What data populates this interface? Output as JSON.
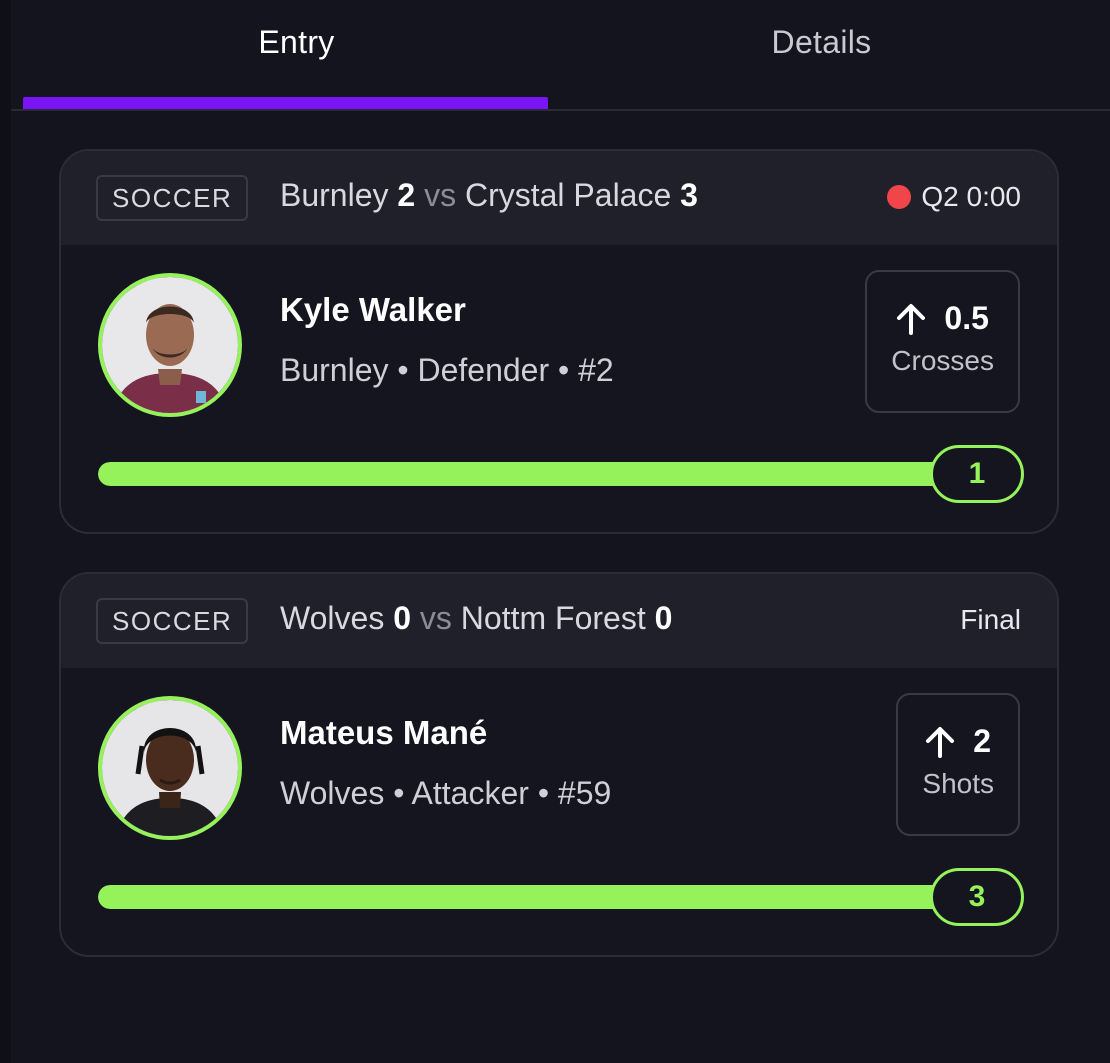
{
  "tabs": [
    {
      "label": "Entry",
      "active": true
    },
    {
      "label": "Details",
      "active": false
    }
  ],
  "colors": {
    "background": "#14141f",
    "accent_purple": "#7a14f5",
    "accent_green": "#95f25a",
    "live_red": "#f2454a"
  },
  "cards": [
    {
      "sport": "SOCCER",
      "home_team": "Burnley",
      "home_score": "2",
      "vs": "vs",
      "away_team": "Crystal Palace",
      "away_score": "3",
      "status": "Q2 0:00",
      "live": true,
      "player": {
        "name": "Kyle Walker",
        "meta": "Burnley • Defender • #2",
        "avatar_icon": "player-photo-icon"
      },
      "pick": {
        "direction": "up",
        "arrow_icon": "arrow-up-icon",
        "line": "0.5",
        "stat": "Crosses"
      },
      "progress": {
        "current": "1",
        "fill_fraction": 1.0
      }
    },
    {
      "sport": "SOCCER",
      "home_team": "Wolves",
      "home_score": "0",
      "vs": "vs",
      "away_team": "Nottm Forest",
      "away_score": "0",
      "status": "Final",
      "live": false,
      "player": {
        "name": "Mateus Mané",
        "meta": "Wolves • Attacker • #59",
        "avatar_icon": "player-photo-icon"
      },
      "pick": {
        "direction": "up",
        "arrow_icon": "arrow-up-icon",
        "line": "2",
        "stat": "Shots"
      },
      "progress": {
        "current": "3",
        "fill_fraction": 1.0
      }
    }
  ]
}
